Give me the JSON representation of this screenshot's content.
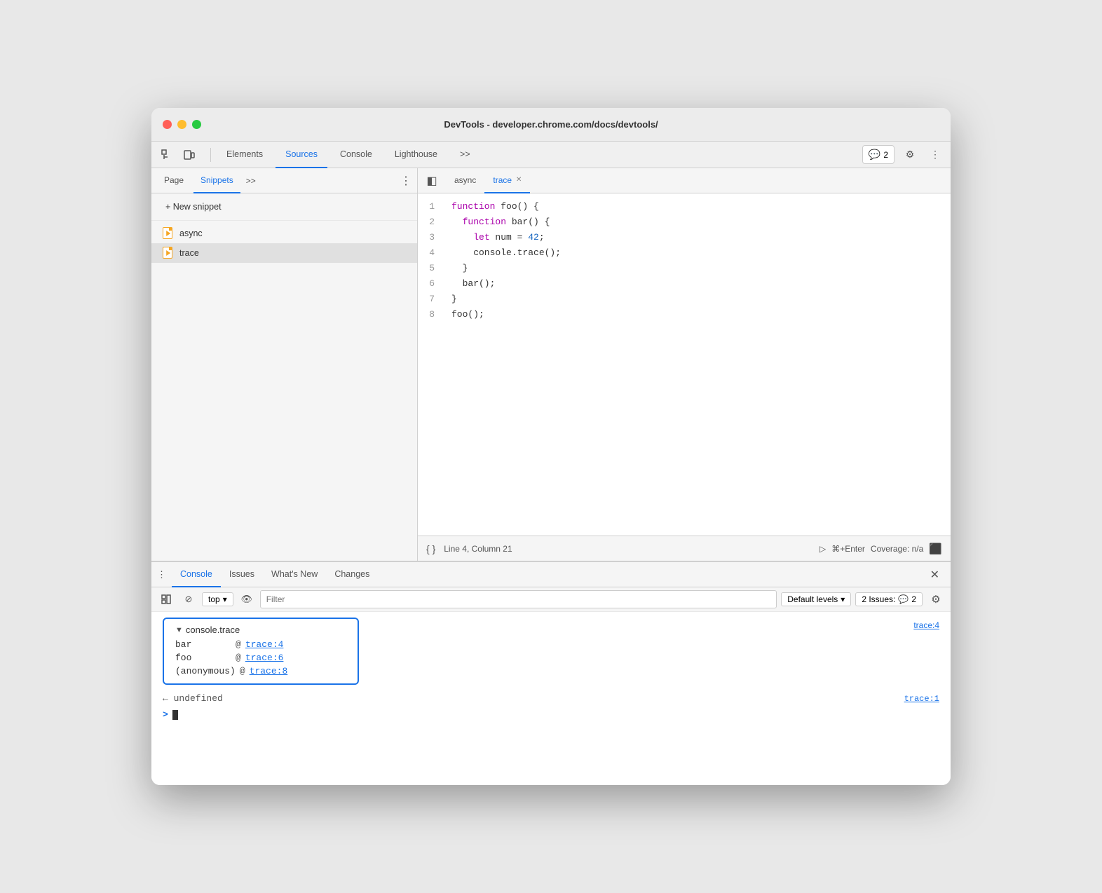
{
  "window": {
    "title": "DevTools - developer.chrome.com/docs/devtools/"
  },
  "nav": {
    "tabs": [
      {
        "label": "Elements",
        "active": false
      },
      {
        "label": "Sources",
        "active": true
      },
      {
        "label": "Console",
        "active": false
      },
      {
        "label": "Lighthouse",
        "active": false
      }
    ],
    "more_label": ">>",
    "badge_count": "2",
    "settings_label": "⚙",
    "more_dots": "⋮"
  },
  "sidebar": {
    "tabs": [
      {
        "label": "Page",
        "active": false
      },
      {
        "label": "Snippets",
        "active": true
      }
    ],
    "more_label": ">>",
    "menu_label": "⋮",
    "new_snippet_label": "+ New snippet",
    "files": [
      {
        "name": "async",
        "active": false
      },
      {
        "name": "trace",
        "active": true
      }
    ]
  },
  "editor": {
    "tabs": [
      {
        "label": "async",
        "active": false,
        "closeable": false
      },
      {
        "label": "trace",
        "active": true,
        "closeable": true
      }
    ],
    "toggle_label": "◧",
    "code_lines": [
      {
        "num": 1,
        "content": "function foo() {",
        "tokens": [
          {
            "type": "kw",
            "text": "function"
          },
          {
            "type": "plain",
            "text": " foo() {"
          }
        ]
      },
      {
        "num": 2,
        "content": "  function bar() {",
        "tokens": [
          {
            "type": "kw",
            "text": "function"
          },
          {
            "type": "plain",
            "text": " bar() {"
          }
        ]
      },
      {
        "num": 3,
        "content": "    let num = 42;",
        "tokens": [
          {
            "type": "kw",
            "text": "let"
          },
          {
            "type": "plain",
            "text": " num = "
          },
          {
            "type": "num",
            "text": "42"
          },
          {
            "type": "plain",
            "text": ";"
          }
        ]
      },
      {
        "num": 4,
        "content": "    console.trace();",
        "tokens": [
          {
            "type": "plain",
            "text": "    console.trace();"
          }
        ]
      },
      {
        "num": 5,
        "content": "  }",
        "tokens": [
          {
            "type": "plain",
            "text": "  }"
          }
        ]
      },
      {
        "num": 6,
        "content": "  bar();",
        "tokens": [
          {
            "type": "plain",
            "text": "  bar();"
          }
        ]
      },
      {
        "num": 7,
        "content": "}",
        "tokens": [
          {
            "type": "plain",
            "text": "}"
          }
        ]
      },
      {
        "num": 8,
        "content": "foo();",
        "tokens": [
          {
            "type": "plain",
            "text": "foo();"
          }
        ]
      }
    ],
    "status": {
      "format_label": "{ }",
      "position": "Line 4, Column 21",
      "run_shortcut": "⌘+Enter",
      "coverage": "Coverage: n/a"
    }
  },
  "bottom_panel": {
    "tabs": [
      {
        "label": "Console",
        "active": true
      },
      {
        "label": "Issues",
        "active": false
      },
      {
        "label": "What's New",
        "active": false
      },
      {
        "label": "Changes",
        "active": false
      }
    ],
    "more_label": "⋮",
    "close_label": "✕",
    "toolbar": {
      "execute_label": "▶",
      "clear_label": "⊘",
      "top_label": "top",
      "eye_label": "👁",
      "filter_placeholder": "Filter",
      "levels_label": "Default levels",
      "issues_label": "2 Issues:",
      "issues_count": "2",
      "settings_label": "⚙"
    },
    "trace_group": {
      "title": "console.trace",
      "source": "trace:4",
      "rows": [
        {
          "fn": "bar",
          "at": "@",
          "link": "trace:4"
        },
        {
          "fn": "foo",
          "at": "@",
          "link": "trace:6"
        },
        {
          "fn": "(anonymous)",
          "at": "@",
          "link": "trace:8"
        }
      ]
    },
    "undefined_row": {
      "text": "← undefined",
      "source": "trace:1"
    },
    "prompt": ">"
  }
}
